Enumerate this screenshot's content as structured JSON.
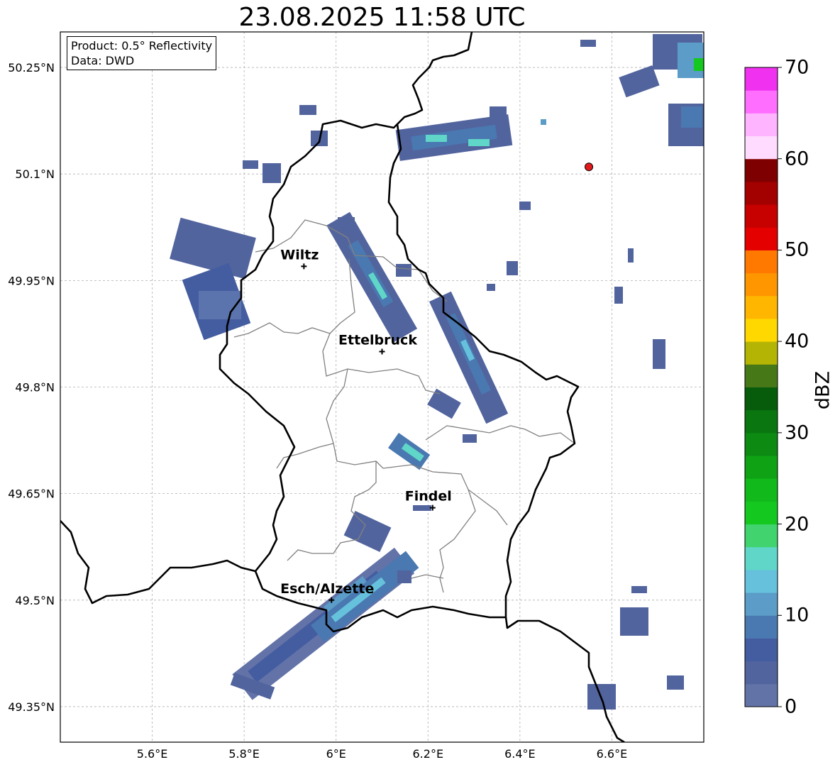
{
  "title": "23.08.2025 11:58 UTC",
  "info": {
    "product": "Product: 0.5° Reflectivity",
    "source": "Data: DWD"
  },
  "map": {
    "lon_range": [
      5.4,
      6.8
    ],
    "lat_range": [
      49.3,
      50.3
    ],
    "lon_ticks": [
      "5.6°E",
      "5.8°E",
      "6°E",
      "6.2°E",
      "6.4°E",
      "6.6°E"
    ],
    "lat_ticks": [
      "50.25°N",
      "50.1°N",
      "49.95°N",
      "49.8°N",
      "49.65°N",
      "49.5°N",
      "49.35°N"
    ],
    "cities": [
      {
        "name": "Wiltz",
        "lon": 5.93,
        "lat": 49.97
      },
      {
        "name": "Ettelbruck",
        "lon": 6.1,
        "lat": 49.85
      },
      {
        "name": "Findel",
        "lon": 6.21,
        "lat": 49.63
      },
      {
        "name": "Esch/Alzette",
        "lon": 5.99,
        "lat": 49.5
      }
    ],
    "radar_site": {
      "lon": 6.55,
      "lat": 50.11,
      "color": "#e31a1c"
    },
    "grid": true
  },
  "colorbar": {
    "label": "dBZ",
    "min": 0,
    "max": 70,
    "ticks": [
      "0",
      "10",
      "20",
      "30",
      "40",
      "50",
      "60",
      "70"
    ],
    "colors": [
      "#6273a8",
      "#52649e",
      "#435da0",
      "#4a78b0",
      "#5b9cc8",
      "#66c1dc",
      "#5fd6c8",
      "#40d36e",
      "#14c820",
      "#12b91a",
      "#0ea214",
      "#0c8a12",
      "#0a760f",
      "#075c0c",
      "#467817",
      "#b4b404",
      "#ffd800",
      "#ffb600",
      "#ff9600",
      "#ff7800",
      "#e50000",
      "#c70000",
      "#a30000",
      "#7f0000",
      "#ffdcff",
      "#ffb4ff",
      "#ff6eff",
      "#f032f0"
    ]
  }
}
